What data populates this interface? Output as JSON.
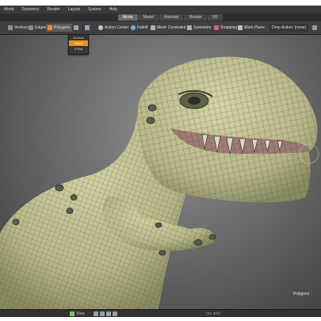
{
  "menubar": {
    "items": [
      "Mode",
      "Dynamics",
      "Render",
      "Layout",
      "System",
      "Help"
    ]
  },
  "layout_tabs": [
    "Mode",
    "Model",
    "Animate",
    "Render",
    "VR"
  ],
  "toolbar": {
    "vertices": "Vertices",
    "edges": "Edges",
    "polygons": "Polygons",
    "action_center": "Action Center",
    "falloff": "Falloff",
    "mesh_constraint": "Mesh Constraint",
    "symmetry": "Symmetry",
    "snapping": "Snapping",
    "work_plane": "Work Plane",
    "drop_action": "Drop Action: (none)"
  },
  "dropdown": {
    "items": [
      "Normal",
      "Ghost",
      "X-Ray"
    ],
    "selected": "Ghost"
  },
  "viewport": {
    "label": "Polygons :"
  },
  "statusbar": {
    "view_label": "View",
    "hint": "(no info)"
  },
  "colors": {
    "accent": "#e8921f",
    "mesh_fill": "#c8c79a",
    "wire": "#3f4b33",
    "background": "#2b2b2b"
  }
}
